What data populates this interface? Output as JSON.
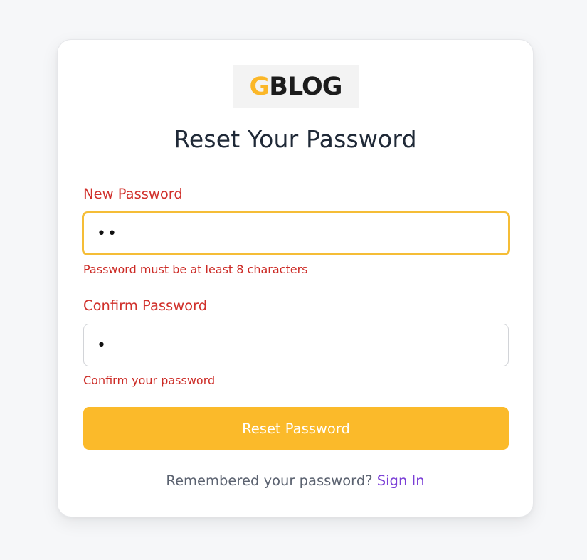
{
  "logo": {
    "letter": "G",
    "rest": "BLOG"
  },
  "title": "Reset Your Password",
  "new_password": {
    "label": "New Password",
    "value": "••",
    "error": "Password must be at least 8 characters"
  },
  "confirm_password": {
    "label": "Confirm Password",
    "value": "•",
    "error": "Confirm your password"
  },
  "submit_label": "Reset Password",
  "footer": {
    "prompt": "Remembered your password?",
    "link": "Sign In"
  },
  "colors": {
    "accent": "#fbba2a",
    "error": "#cc2b26",
    "link": "#7a3ed6",
    "background": "#f6f7f9"
  },
  "icons": {
    "logo": "gblog-logo"
  }
}
